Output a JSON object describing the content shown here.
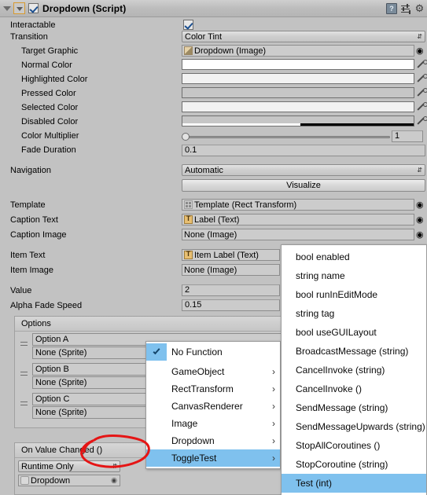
{
  "header": {
    "title": "Dropdown (Script)",
    "enabled_checkbox": true,
    "icons": {
      "help": "help-book-icon",
      "preset": "preset-sliders-icon",
      "gear": "gear-icon"
    },
    "help_glyph": "?",
    "gear_glyph": "⚙"
  },
  "properties": {
    "interactable": {
      "label": "Interactable",
      "checked": true
    },
    "transition": {
      "label": "Transition",
      "value": "Color Tint"
    },
    "target_graphic": {
      "label": "Target Graphic",
      "value": "Dropdown (Image)"
    },
    "normal_color": {
      "label": "Normal Color",
      "color": "#ffffff",
      "alpha": 100
    },
    "highlighted_color": {
      "label": "Highlighted Color",
      "color": "#f5f5f5",
      "alpha": 100
    },
    "pressed_color": {
      "label": "Pressed Color",
      "color": "#c8c8c8",
      "alpha": 100
    },
    "selected_color": {
      "label": "Selected Color",
      "color": "#f5f5f5",
      "alpha": 100
    },
    "disabled_color": {
      "label": "Disabled Color",
      "color": "#c8c8c8",
      "alpha": 50
    },
    "color_multiplier": {
      "label": "Color Multiplier",
      "value": "1",
      "slider_percent": 0
    },
    "fade_duration": {
      "label": "Fade Duration",
      "value": "0.1"
    },
    "navigation": {
      "label": "Navigation",
      "value": "Automatic"
    },
    "visualize_button": {
      "label": "Visualize"
    },
    "template": {
      "label": "Template",
      "value": "Template (Rect Transform)"
    },
    "caption_text": {
      "label": "Caption Text",
      "value": "Label (Text)"
    },
    "caption_image": {
      "label": "Caption Image",
      "value": "None (Image)"
    },
    "item_text": {
      "label": "Item Text",
      "value": "Item Label (Text)"
    },
    "item_image": {
      "label": "Item Image",
      "value": "None (Image)"
    },
    "value": {
      "label": "Value",
      "value": "2"
    },
    "alpha_fade_speed": {
      "label": "Alpha Fade Speed",
      "value": "0.15"
    }
  },
  "options_list": {
    "header": "Options",
    "entries": [
      {
        "text": "Option A",
        "sprite": "None (Sprite)"
      },
      {
        "text": "Option B",
        "sprite": "None (Sprite)"
      },
      {
        "text": "Option C",
        "sprite": "None (Sprite)"
      }
    ]
  },
  "event": {
    "header": "On Value Changed ()",
    "mode": "Runtime Only",
    "object": "Dropdown"
  },
  "context_menu": {
    "items": [
      {
        "label": "No Function",
        "checked": true,
        "submenu": false,
        "highlighted": false
      },
      {
        "label": "GameObject",
        "checked": false,
        "submenu": true,
        "highlighted": false
      },
      {
        "label": "RectTransform",
        "checked": false,
        "submenu": true,
        "highlighted": false
      },
      {
        "label": "CanvasRenderer",
        "checked": false,
        "submenu": true,
        "highlighted": false
      },
      {
        "label": "Image",
        "checked": false,
        "submenu": true,
        "highlighted": false
      },
      {
        "label": "Dropdown",
        "checked": false,
        "submenu": true,
        "highlighted": false
      },
      {
        "label": "ToggleTest",
        "checked": false,
        "submenu": true,
        "highlighted": true
      }
    ],
    "submenu_arrow": "›"
  },
  "submenu": {
    "items": [
      {
        "label": "bool enabled",
        "highlighted": false
      },
      {
        "label": "string name",
        "highlighted": false
      },
      {
        "label": "bool runInEditMode",
        "highlighted": false
      },
      {
        "label": "string tag",
        "highlighted": false
      },
      {
        "label": "bool useGUILayout",
        "highlighted": false
      },
      {
        "label": "BroadcastMessage (string)",
        "highlighted": false
      },
      {
        "label": "CancelInvoke (string)",
        "highlighted": false
      },
      {
        "label": "CancelInvoke ()",
        "highlighted": false
      },
      {
        "label": "SendMessage (string)",
        "highlighted": false
      },
      {
        "label": "SendMessageUpwards (string)",
        "highlighted": false
      },
      {
        "label": "StopAllCoroutines ()",
        "highlighted": false
      },
      {
        "label": "StopCoroutine (string)",
        "highlighted": false
      },
      {
        "label": "Test (int)",
        "highlighted": true
      }
    ]
  },
  "annotation": {
    "shape": "hand-drawn-red-circle",
    "color": "#e51515",
    "target": "On Value Changed ()"
  },
  "colors": {
    "background": "#c2c2c2",
    "menu_highlight": "#7fc1ee",
    "menu_background": "#ffffff",
    "annotation_red": "#e51515"
  }
}
